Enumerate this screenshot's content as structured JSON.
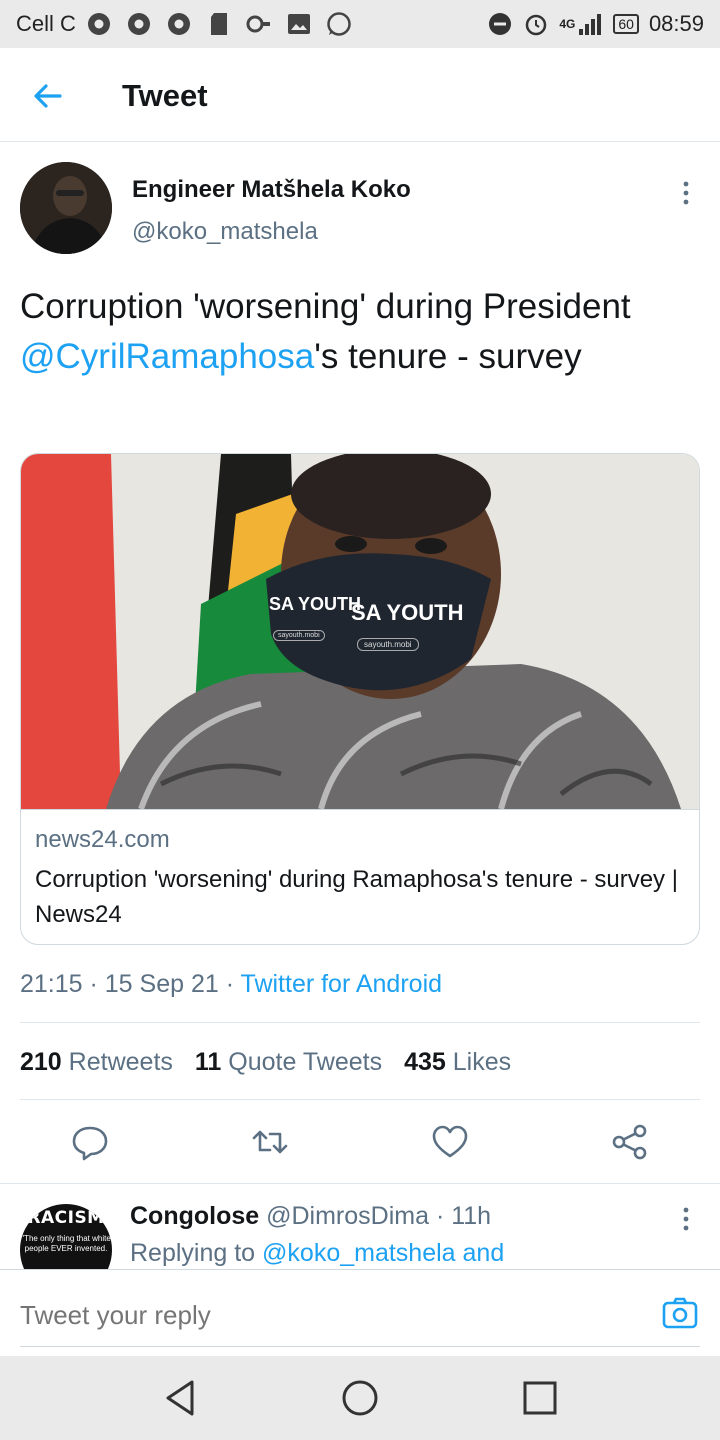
{
  "status_bar": {
    "carrier": "Cell C",
    "network": "4G",
    "battery": "60",
    "time": "08:59"
  },
  "header": {
    "title": "Tweet",
    "back_icon": "arrow-left-icon"
  },
  "tweet": {
    "author_name": "Engineer Matšhela Koko",
    "author_handle": "@koko_matshela",
    "text_before": "Corruption 'worsening' during President ",
    "text_mention": "@CyrilRamaphosa",
    "text_after": "'s tenure - survey",
    "card": {
      "image_mask_text_left": "SA YOUTH",
      "image_mask_text_right": "SA YOUTH",
      "image_mask_url_left": "sayouth.mobi",
      "image_mask_url_right": "sayouth.mobi",
      "domain": "news24.com",
      "title": "Corruption 'worsening' during Ramaphosa's tenure - survey | News24"
    },
    "time": "21:15",
    "date": "15 Sep 21",
    "source": "Twitter for Android",
    "stats": {
      "retweets_count": "210",
      "retweets_label": "Retweets",
      "quotes_count": "11",
      "quotes_label": "Quote Tweets",
      "likes_count": "435",
      "likes_label": "Likes"
    }
  },
  "reply": {
    "avatar_text": "RACISM",
    "avatar_caption": "\"The only thing that white people EVER invented.",
    "name": "Congolose",
    "handle": "@DimrosDima",
    "age": "11h",
    "replying_prefix": "Replying to ",
    "replying_to": "@koko_matshela and"
  },
  "compose": {
    "placeholder": "Tweet your reply"
  },
  "colors": {
    "accent": "#1da1f2",
    "muted": "#5b7083",
    "text": "#14171a"
  }
}
